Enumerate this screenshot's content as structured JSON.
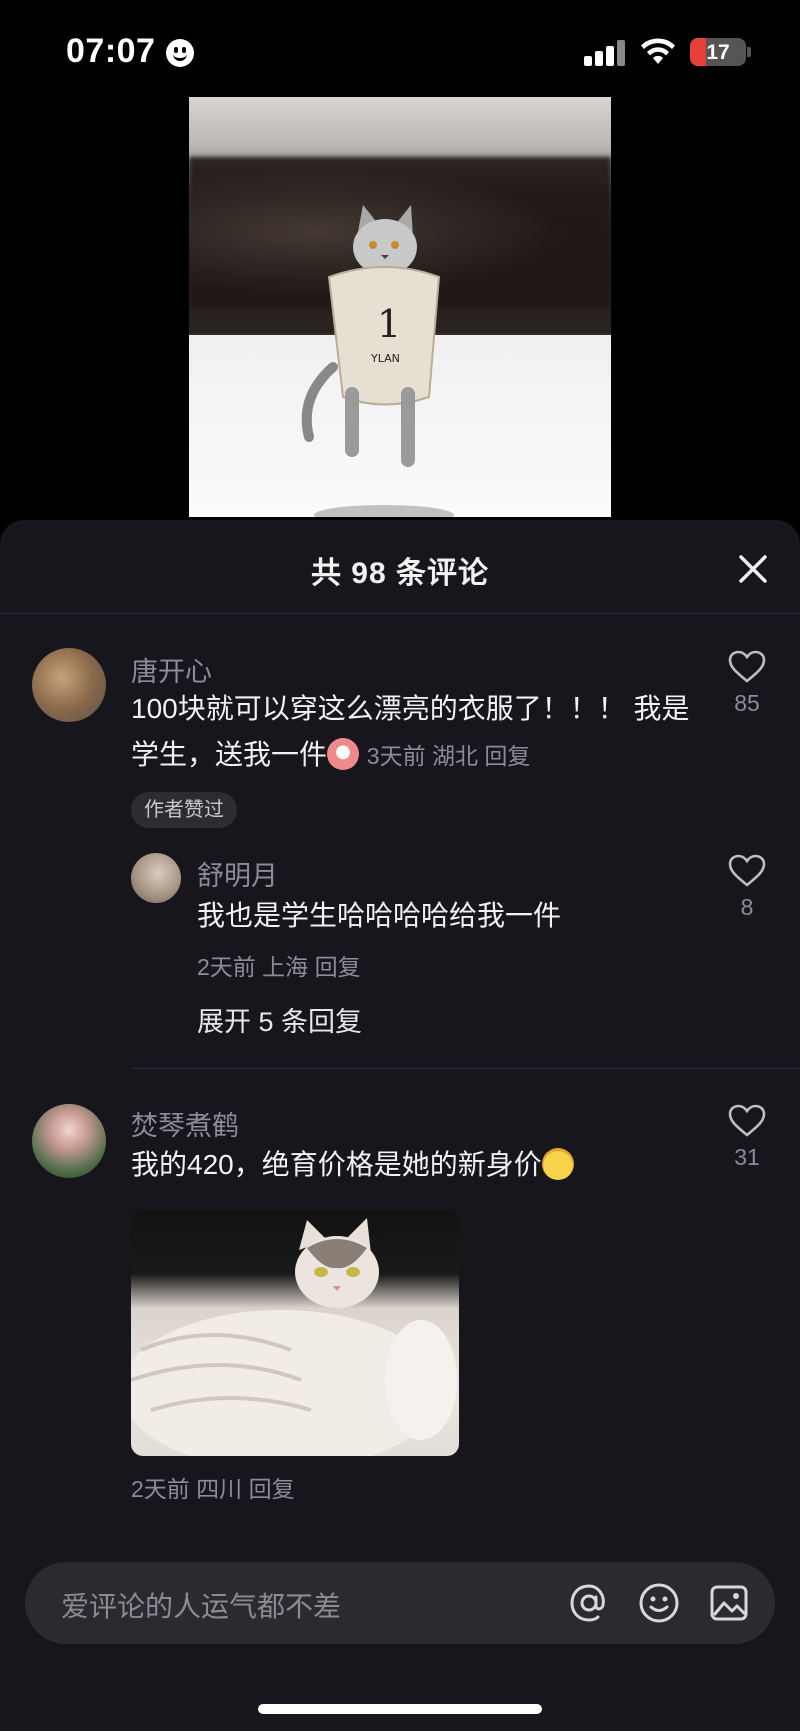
{
  "status_bar": {
    "time": "07:07",
    "battery": "17"
  },
  "sheet": {
    "title": "共 98 条评论"
  },
  "comments": [
    {
      "username": "唐开心",
      "text": "100块就可以穿这么漂亮的衣服了！！！ 我是学生，送我一件",
      "meta": "3天前 湖北 回复",
      "likes": "85",
      "badge": "作者赞过"
    },
    {
      "username": "舒明月",
      "text": "我也是学生哈哈哈哈给我一件",
      "meta": "2天前 上海 回复",
      "likes": "8"
    },
    {
      "username": "焚琴煮鹤",
      "text": "我的420，绝育价格是她的新身价",
      "meta": "2天前 四川 回复",
      "likes": "31"
    }
  ],
  "expand_replies": "展开 5 条回复",
  "input": {
    "placeholder": "爱评论的人运气都不差"
  },
  "icons": {
    "mention": "at-icon",
    "emoji": "smiley-icon",
    "image": "image-icon",
    "close": "close-icon",
    "like": "heart-icon"
  }
}
